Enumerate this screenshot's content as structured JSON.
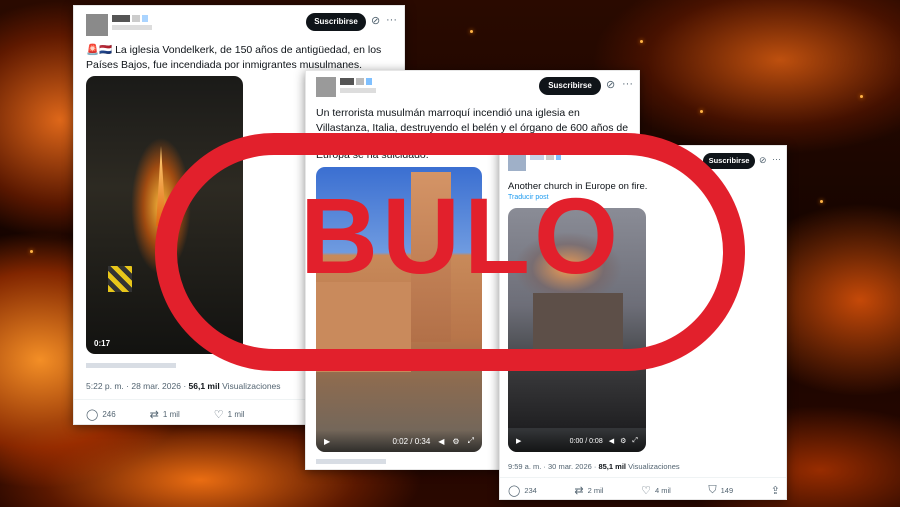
{
  "tweet1": {
    "subscribe_label": "Suscribirse",
    "flags": "🚨🇳🇱",
    "text": "La iglesia Vondelkerk, de 150 años de antigüedad, en los Países Bajos, fue incendiada por inmigrantes musulmanes.",
    "video_time": "0:17",
    "timestamp": "5:22 p. m. · 28 mar. 2026 · ",
    "views_count": "56,1 mil",
    "views_label": "Visualizaciones",
    "replies": "246",
    "reposts": "1 mil",
    "likes": "1 mil"
  },
  "tweet2": {
    "subscribe_label": "Suscribirse",
    "text": "Un terrorista musulmán marroquí incendió una iglesia en Villastanza, Italia, destruyendo el belén y el órgano de 600 años de antigüedad.",
    "text2": "Europa se ha suicidado.",
    "video_time": "0:02 / 0:34"
  },
  "tweet3": {
    "subscribe_label": "Suscribirse",
    "text": "Another church in Europe on fire.",
    "translate_label": "Traducir post",
    "video_time": "0:00 / 0:08",
    "timestamp": "9:59 a. m. · 30 mar. 2026 · ",
    "views_count": "85,1 mil",
    "views_label": "Visualizaciones",
    "replies": "234",
    "reposts": "2 mil",
    "likes": "4 mil",
    "bookmarks": "149"
  },
  "stamp": {
    "label": "BULO",
    "color": "#e2202c"
  },
  "icons": {
    "more": "more-icon",
    "grok": "grok-icon",
    "reply": "reply-icon",
    "repost": "repost-icon",
    "like": "heart-icon",
    "bookmark": "bookmark-icon",
    "share": "share-icon",
    "play": "play-icon"
  }
}
